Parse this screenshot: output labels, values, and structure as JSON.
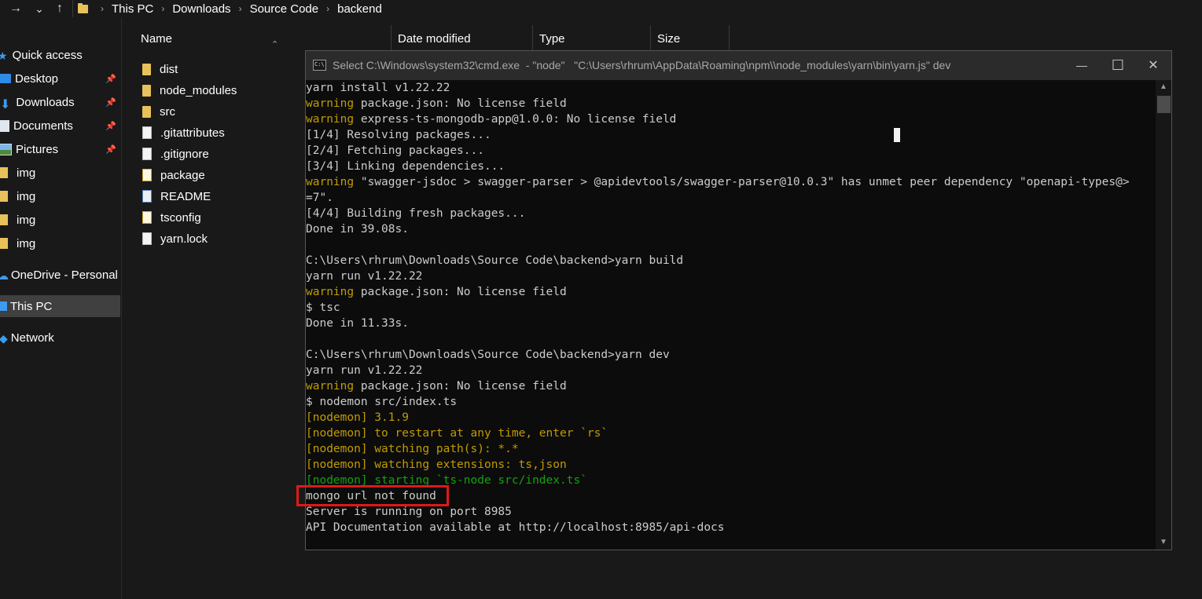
{
  "addressbar": {
    "forward_icon": "→",
    "recent_icon": "⌄",
    "up_icon": "↑",
    "crumbs": [
      "This PC",
      "Downloads",
      "Source Code",
      "backend"
    ],
    "separator": "›"
  },
  "navpane": {
    "items": [
      {
        "label": "Quick access",
        "icon": "star-icon"
      },
      {
        "label": "Desktop",
        "icon": "desktop-icon",
        "pinned": true
      },
      {
        "label": "Downloads",
        "icon": "download-icon",
        "pinned": true
      },
      {
        "label": "Documents",
        "icon": "documents-icon",
        "pinned": true
      },
      {
        "label": "Pictures",
        "icon": "pictures-icon",
        "pinned": true
      },
      {
        "label": "img",
        "icon": "folder-icon"
      },
      {
        "label": "img",
        "icon": "folder-icon"
      },
      {
        "label": "img",
        "icon": "folder-icon"
      },
      {
        "label": "img",
        "icon": "folder-icon"
      },
      {
        "label": "OneDrive - Personal",
        "icon": "cloud-icon"
      },
      {
        "label": "This PC",
        "icon": "computer-icon",
        "selected": true
      },
      {
        "label": "Network",
        "icon": "network-icon"
      }
    ]
  },
  "filelist": {
    "columns": [
      "Name",
      "Date modified",
      "Type",
      "Size"
    ],
    "files": [
      {
        "name": "dist",
        "icon": "folder-icon"
      },
      {
        "name": "node_modules",
        "icon": "folder-icon"
      },
      {
        "name": "src",
        "icon": "folder-icon"
      },
      {
        "name": ".gitattributes",
        "icon": "file-icon"
      },
      {
        "name": ".gitignore",
        "icon": "file-icon"
      },
      {
        "name": "package",
        "icon": "json-file-icon"
      },
      {
        "name": "README",
        "icon": "readme-file-icon"
      },
      {
        "name": "tsconfig",
        "icon": "json-file-icon"
      },
      {
        "name": "yarn.lock",
        "icon": "file-icon"
      }
    ]
  },
  "cmd": {
    "title": "Select C:\\Windows\\system32\\cmd.exe  - \"node\"   \"C:\\Users\\rhrum\\AppData\\Roaming\\npm\\\\node_modules\\yarn\\bin\\yarn.js\" dev",
    "minimize_icon": "—",
    "maximize_icon": "☐",
    "close_icon": "✕",
    "lines": [
      [
        {
          "t": "yarn install v1.22.22"
        }
      ],
      [
        {
          "t": "warning",
          "c": "warn"
        },
        {
          "t": " package.json: No license field"
        }
      ],
      [
        {
          "t": "warning",
          "c": "warn"
        },
        {
          "t": " express-ts-mongodb-app@1.0.0: No license field"
        }
      ],
      [
        {
          "t": "[1/4] Resolving packages..."
        }
      ],
      [
        {
          "t": "[2/4] Fetching packages..."
        }
      ],
      [
        {
          "t": "[3/4] Linking dependencies..."
        }
      ],
      [
        {
          "t": "warning",
          "c": "warn"
        },
        {
          "t": " \"swagger-jsdoc > swagger-parser > @apidevtools/swagger-parser@10.0.3\" has unmet peer dependency \"openapi-types@>"
        }
      ],
      [
        {
          "t": "=7\"."
        }
      ],
      [
        {
          "t": "[4/4] Building fresh packages..."
        }
      ],
      [
        {
          "t": "Done in 39.08s."
        }
      ],
      [
        {
          "t": ""
        }
      ],
      [
        {
          "t": "C:\\Users\\rhrum\\Downloads\\Source Code\\backend>yarn build"
        }
      ],
      [
        {
          "t": "yarn run v1.22.22"
        }
      ],
      [
        {
          "t": "warning",
          "c": "warn"
        },
        {
          "t": " package.json: No license field"
        }
      ],
      [
        {
          "t": "$ tsc"
        }
      ],
      [
        {
          "t": "Done in 11.33s."
        }
      ],
      [
        {
          "t": ""
        }
      ],
      [
        {
          "t": "C:\\Users\\rhrum\\Downloads\\Source Code\\backend>yarn dev"
        }
      ],
      [
        {
          "t": "yarn run v1.22.22"
        }
      ],
      [
        {
          "t": "warning",
          "c": "warn"
        },
        {
          "t": " package.json: No license field"
        }
      ],
      [
        {
          "t": "$ nodemon src/index.ts"
        }
      ],
      [
        {
          "t": "[nodemon] 3.1.9",
          "c": "yellow"
        }
      ],
      [
        {
          "t": "[nodemon] to restart at any time, enter `rs`",
          "c": "yellow"
        }
      ],
      [
        {
          "t": "[nodemon] watching path(s): *.*",
          "c": "yellow"
        }
      ],
      [
        {
          "t": "[nodemon] watching extensions: ts,json",
          "c": "yellow"
        }
      ],
      [
        {
          "t": "[nodemon] starting `ts-node src/index.ts`",
          "c": "green"
        }
      ],
      [
        {
          "t": "mongo url not found"
        }
      ],
      [
        {
          "t": "Server is running on port 8985"
        }
      ],
      [
        {
          "t": "API Documentation available at http://localhost:8985/api-docs"
        }
      ]
    ]
  },
  "colors": {
    "warn": "#c19c00",
    "nodemon_yellow": "#c19c00",
    "nodemon_green": "#13a10e",
    "highlight_box": "#e01818",
    "folder": "#e8c15a",
    "accent_blue": "#3b9cf0"
  }
}
